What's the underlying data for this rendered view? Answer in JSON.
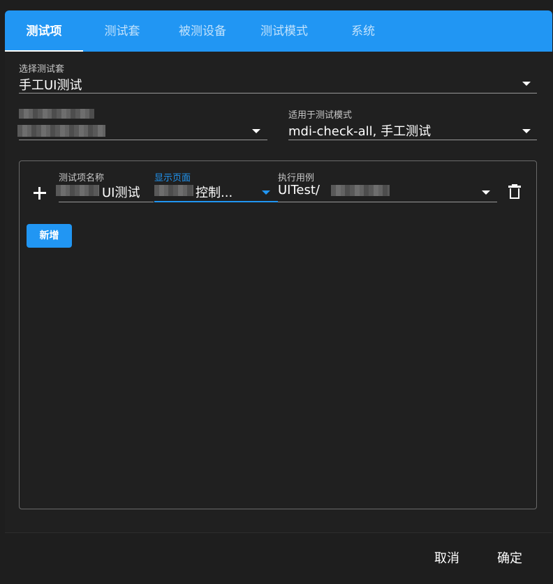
{
  "tabs": [
    {
      "label": "测试项",
      "active": true
    },
    {
      "label": "测试套",
      "active": false
    },
    {
      "label": "被测设备",
      "active": false
    },
    {
      "label": "测试模式",
      "active": false
    },
    {
      "label": "系统",
      "active": false
    }
  ],
  "suite_select": {
    "label": "选择测试套",
    "value": "手工UI测试"
  },
  "mode_select": {
    "label": "适用于测试模式",
    "value": "mdi-check-all, 手工测试"
  },
  "item_row": {
    "name_label": "测试项名称",
    "name_value": "UI测试",
    "page_label": "显示页面",
    "page_value": "控制...",
    "case_label": "执行用例",
    "case_value": "UITest/"
  },
  "add_button": "新增",
  "footer": {
    "cancel": "取消",
    "confirm": "确定"
  },
  "colors": {
    "accent": "#2196f3",
    "background": "#1e1e1e",
    "panel_border": "#6a6a6a"
  },
  "icons": [
    "plus-icon",
    "trash-icon",
    "chevron-down-icon"
  ]
}
